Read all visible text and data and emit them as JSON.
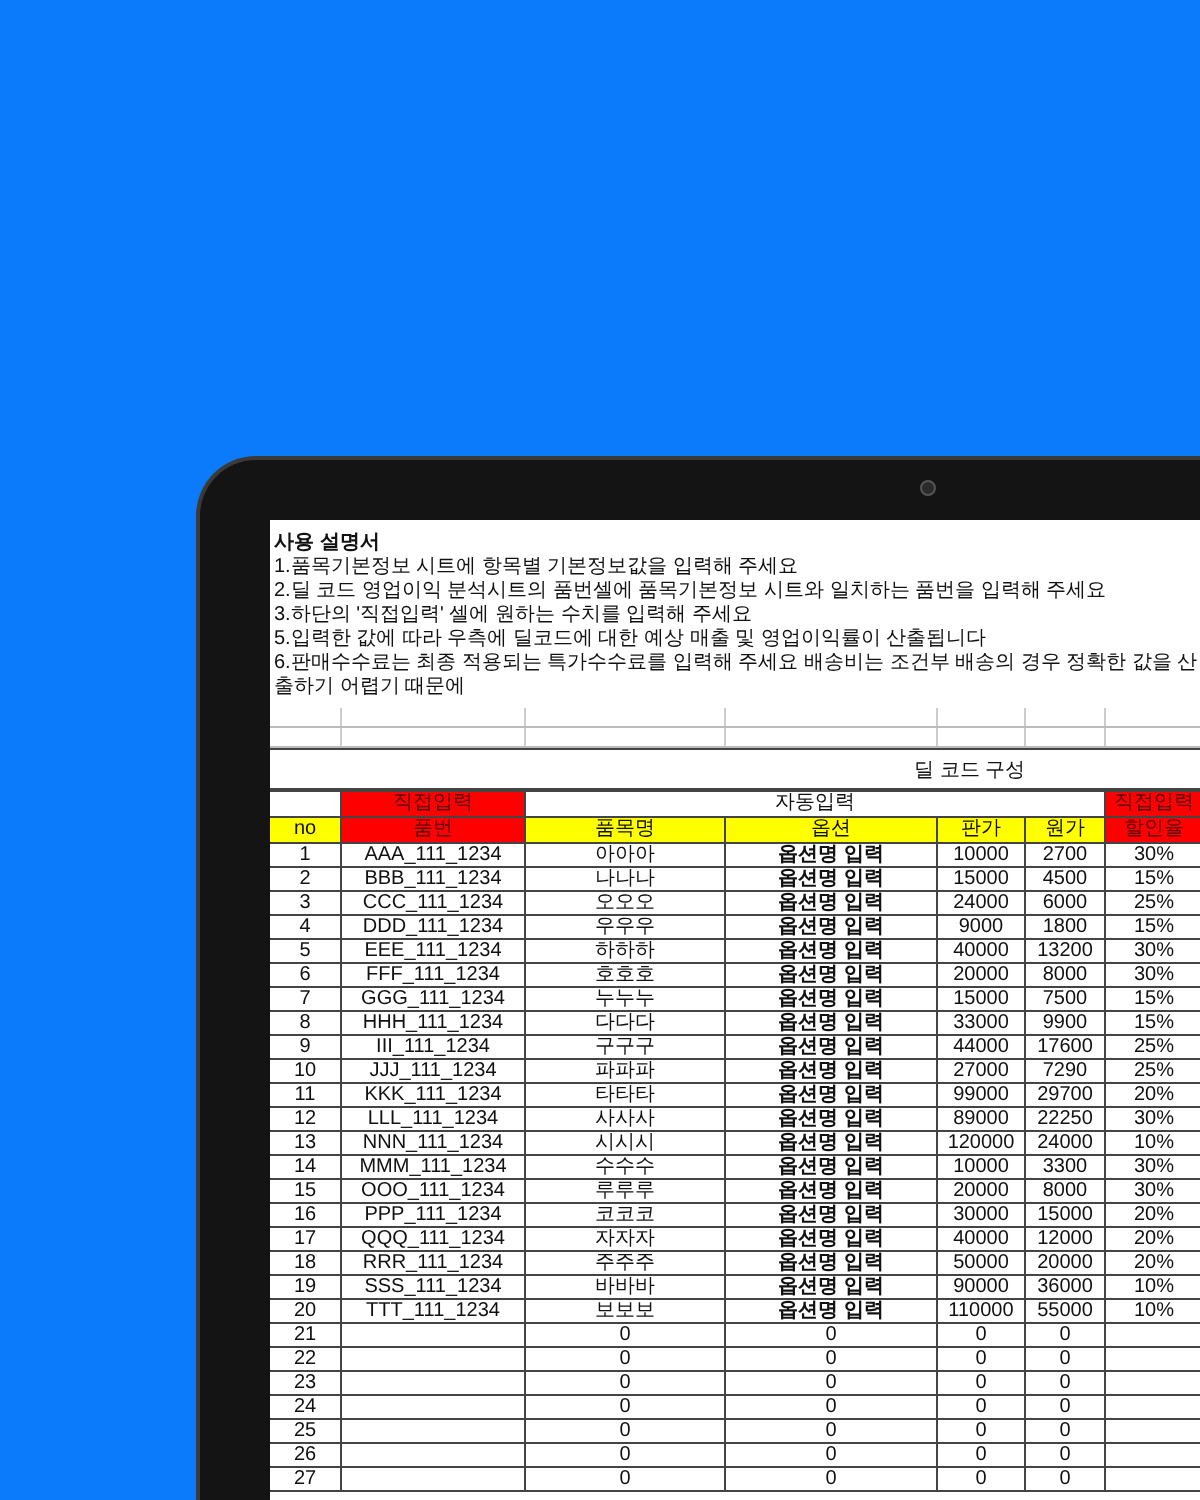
{
  "guide": {
    "title": "사용 설명서",
    "lines": [
      "1.품목기본정보 시트에 항목별 기본정보값을 입력해 주세요",
      "2.딜 코드 영업이익 분석시트의 품번셀에 품목기본정보 시트와 일치하는 품번을 입력해 주세요",
      "3.하단의 '직접입력' 셀에 원하는 수치를 입력해 주세요",
      "5.입력한 값에 따라 우측에 딜코드에 대한 예상 매출 및 영업이익률이 산출됩니다",
      "6.판매수수료는 최종 적용되는 특가수수료를 입력해 주세요 배송비는 조건부 배송의 경우 정확한 값을 산출하기 어렵기 때문에"
    ]
  },
  "table": {
    "title": "딜 코드 구성",
    "groups": [
      {
        "kind": "none",
        "columns": [
          "no"
        ]
      },
      {
        "kind": "manual",
        "label": "직접입력",
        "columns": [
          "품번"
        ]
      },
      {
        "kind": "auto",
        "label": "자동입력",
        "columns": [
          "품목명",
          "옵션",
          "판가",
          "원가"
        ]
      },
      {
        "kind": "manual",
        "label": "직접입력",
        "columns": [
          "할인율"
        ]
      }
    ],
    "rows": [
      [
        "1",
        "AAA_111_1234",
        "아아아",
        "옵션명 입력",
        "10000",
        "2700",
        "30%"
      ],
      [
        "2",
        "BBB_111_1234",
        "나나나",
        "옵션명 입력",
        "15000",
        "4500",
        "15%"
      ],
      [
        "3",
        "CCC_111_1234",
        "오오오",
        "옵션명 입력",
        "24000",
        "6000",
        "25%"
      ],
      [
        "4",
        "DDD_111_1234",
        "우우우",
        "옵션명 입력",
        "9000",
        "1800",
        "15%"
      ],
      [
        "5",
        "EEE_111_1234",
        "하하하",
        "옵션명 입력",
        "40000",
        "13200",
        "30%"
      ],
      [
        "6",
        "FFF_111_1234",
        "호호호",
        "옵션명 입력",
        "20000",
        "8000",
        "30%"
      ],
      [
        "7",
        "GGG_111_1234",
        "누누누",
        "옵션명 입력",
        "15000",
        "7500",
        "15%"
      ],
      [
        "8",
        "HHH_111_1234",
        "다다다",
        "옵션명 입력",
        "33000",
        "9900",
        "15%"
      ],
      [
        "9",
        "III_111_1234",
        "구구구",
        "옵션명 입력",
        "44000",
        "17600",
        "25%"
      ],
      [
        "10",
        "JJJ_111_1234",
        "파파파",
        "옵션명 입력",
        "27000",
        "7290",
        "25%"
      ],
      [
        "11",
        "KKK_111_1234",
        "타타타",
        "옵션명 입력",
        "99000",
        "29700",
        "20%"
      ],
      [
        "12",
        "LLL_111_1234",
        "사사사",
        "옵션명 입력",
        "89000",
        "22250",
        "30%"
      ],
      [
        "13",
        "NNN_111_1234",
        "시시시",
        "옵션명 입력",
        "120000",
        "24000",
        "10%"
      ],
      [
        "14",
        "MMM_111_1234",
        "수수수",
        "옵션명 입력",
        "10000",
        "3300",
        "30%"
      ],
      [
        "15",
        "OOO_111_1234",
        "루루루",
        "옵션명 입력",
        "20000",
        "8000",
        "30%"
      ],
      [
        "16",
        "PPP_111_1234",
        "코코코",
        "옵션명 입력",
        "30000",
        "15000",
        "20%"
      ],
      [
        "17",
        "QQQ_111_1234",
        "자자자",
        "옵션명 입력",
        "40000",
        "12000",
        "20%"
      ],
      [
        "18",
        "RRR_111_1234",
        "주주주",
        "옵션명 입력",
        "50000",
        "20000",
        "20%"
      ],
      [
        "19",
        "SSS_111_1234",
        "바바바",
        "옵션명 입력",
        "90000",
        "36000",
        "10%"
      ],
      [
        "20",
        "TTT_111_1234",
        "보보보",
        "옵션명 입력",
        "110000",
        "55000",
        "10%"
      ],
      [
        "21",
        null,
        "0",
        "0",
        "0",
        "0",
        null
      ],
      [
        "22",
        null,
        "0",
        "0",
        "0",
        "0",
        null
      ],
      [
        "23",
        null,
        "0",
        "0",
        "0",
        "0",
        null
      ],
      [
        "24",
        null,
        "0",
        "0",
        "0",
        "0",
        null
      ],
      [
        "25",
        null,
        "0",
        "0",
        "0",
        "0",
        null
      ],
      [
        "26",
        null,
        "0",
        "0",
        "0",
        "0",
        null
      ],
      [
        "27",
        null,
        "0",
        "0",
        "0",
        "0",
        null
      ]
    ]
  }
}
